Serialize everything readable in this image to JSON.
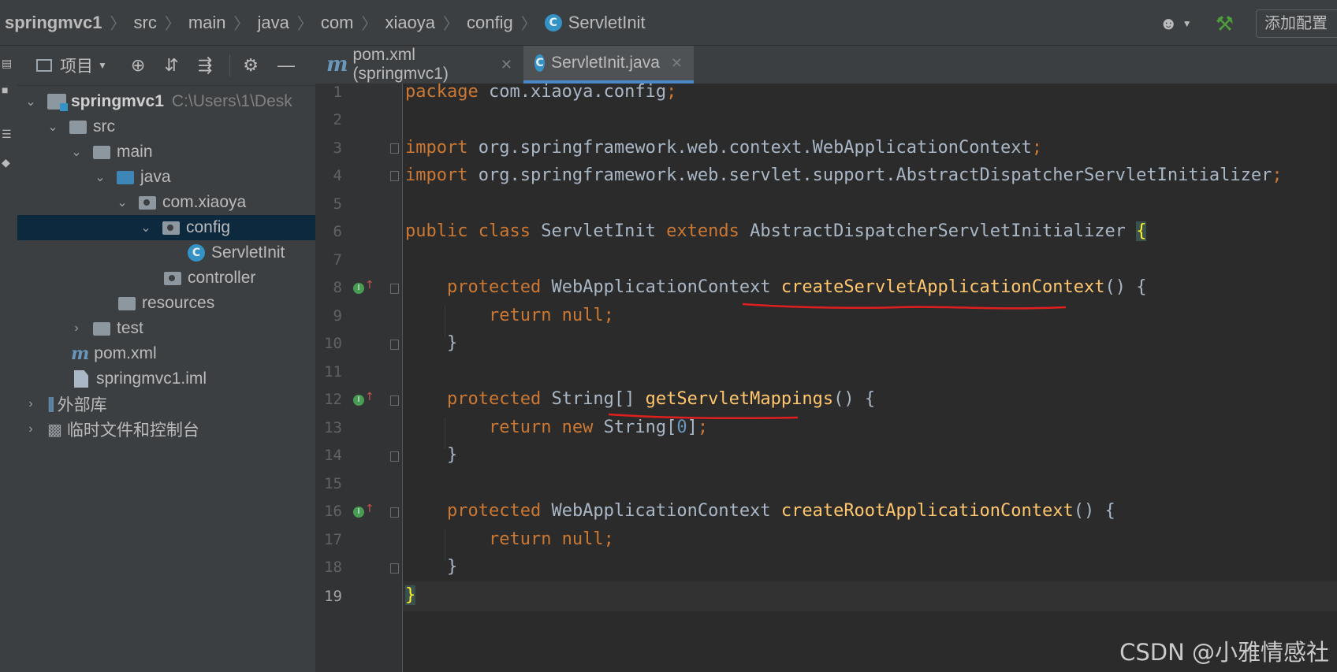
{
  "breadcrumbs": [
    "springmvc1",
    "src",
    "main",
    "java",
    "com",
    "xiaoya",
    "config"
  ],
  "breadcrumb_file": "ServletInit",
  "toolbar": {
    "add_config": "添加配置"
  },
  "project_panel": {
    "title": "项目",
    "tree": [
      {
        "label": "springmvc1",
        "path": "C:\\Users\\1\\Desk",
        "depth": 0,
        "expanded": true,
        "icon": "module"
      },
      {
        "label": "src",
        "depth": 1,
        "expanded": true,
        "icon": "folder"
      },
      {
        "label": "main",
        "depth": 2,
        "expanded": true,
        "icon": "folder"
      },
      {
        "label": "java",
        "depth": 3,
        "expanded": true,
        "icon": "source-folder"
      },
      {
        "label": "com.xiaoya",
        "depth": 4,
        "expanded": true,
        "icon": "package"
      },
      {
        "label": "config",
        "depth": 5,
        "expanded": true,
        "icon": "package",
        "selected": true
      },
      {
        "label": "ServletInit",
        "depth": 6,
        "icon": "class"
      },
      {
        "label": "controller",
        "depth": 5,
        "icon": "package"
      },
      {
        "label": "resources",
        "depth": 4,
        "icon": "resources-folder"
      },
      {
        "label": "test",
        "depth": 2,
        "expanded": false,
        "icon": "folder"
      },
      {
        "label": "pom.xml",
        "depth": 2,
        "icon": "maven"
      },
      {
        "label": "springmvc1.iml",
        "depth": 2,
        "icon": "file"
      },
      {
        "label": "外部库",
        "depth": 0,
        "expanded": false,
        "icon": "library"
      },
      {
        "label": "临时文件和控制台",
        "depth": 0,
        "expanded": false,
        "icon": "console"
      }
    ]
  },
  "tabs": [
    {
      "label": "pom.xml (springmvc1)",
      "icon": "maven",
      "active": false
    },
    {
      "label": "ServletInit.java",
      "icon": "class",
      "active": true
    }
  ],
  "editor": {
    "current_line": 19,
    "lines": [
      {
        "n": "1"
      },
      {
        "n": "2"
      },
      {
        "n": "3"
      },
      {
        "n": "4"
      },
      {
        "n": "5"
      },
      {
        "n": "6"
      },
      {
        "n": "7"
      },
      {
        "n": "8"
      },
      {
        "n": "9"
      },
      {
        "n": "10"
      },
      {
        "n": "11"
      },
      {
        "n": "12"
      },
      {
        "n": "13"
      },
      {
        "n": "14"
      },
      {
        "n": "15"
      },
      {
        "n": "16"
      },
      {
        "n": "17"
      },
      {
        "n": "18"
      },
      {
        "n": "19"
      }
    ],
    "code": {
      "l1_kw": "package",
      "l1_rest": " com.xiaoya.config",
      "l1_semi": ";",
      "l3_kw": "import",
      "l3_rest": " org.springframework.web.context.WebApplicationContext",
      "l3_semi": ";",
      "l4_kw": "import",
      "l4_rest": " org.springframework.web.servlet.support.AbstractDispatcherServletInitializer",
      "l4_semi": ";",
      "l6_kw1": "public class",
      "l6_name": " ServletInit ",
      "l6_kw2": "extends",
      "l6_rest": " AbstractDispatcherServletInitializer ",
      "l6_brace": "{",
      "l8_kw": "protected",
      "l8_type": " WebApplicationContext ",
      "l8_fn": "createServletApplicationContext",
      "l8_rest": "() {",
      "l9_kw": "return null",
      "l9_semi": ";",
      "close_brace": "}",
      "l12_kw": "protected",
      "l12_type": " String[] ",
      "l12_fn": "getServletMappings",
      "l12_rest": "() {",
      "l13_kw1": "return new",
      "l13_type": " String[",
      "l13_num": "0",
      "l13_end": "]",
      "l13_semi": ";",
      "l16_kw": "protected",
      "l16_type": " WebApplicationContext ",
      "l16_fn": "createRootApplicationContext",
      "l16_rest": "() {",
      "l17_kw": "return null",
      "l17_semi": ";",
      "l19_brace": "}"
    }
  },
  "watermark": "CSDN @小雅情感社",
  "colors": {
    "keyword": "#cc7832",
    "method": "#ffc66d",
    "text": "#a9b7c6",
    "number": "#6897bb",
    "annotation_line": "#e0201e"
  }
}
